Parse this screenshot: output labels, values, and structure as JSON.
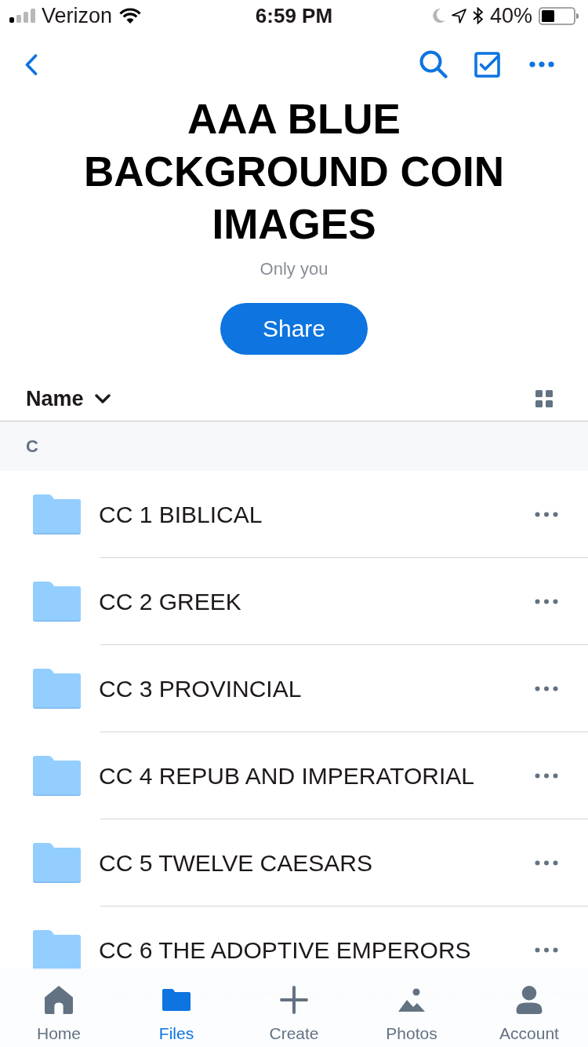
{
  "status_bar": {
    "carrier": "Verizon",
    "time": "6:59 PM",
    "battery_percent": "40%"
  },
  "title": "AAA BLUE BACKGROUND COIN IMAGES",
  "subtitle": "Only you",
  "share_button": "Share",
  "sort": {
    "label": "Name"
  },
  "section": {
    "header": "C"
  },
  "folders": [
    {
      "name": "CC 1 BIBLICAL"
    },
    {
      "name": "CC 2 GREEK"
    },
    {
      "name": "CC 3 PROVINCIAL"
    },
    {
      "name": "CC 4 REPUB AND IMPERATORIAL"
    },
    {
      "name": "CC 5 TWELVE CAESARS"
    },
    {
      "name": "CC 6 THE ADOPTIVE EMPERORS"
    }
  ],
  "tabs": [
    {
      "label": "Home",
      "kind": "home",
      "selected": false
    },
    {
      "label": "Files",
      "kind": "files",
      "selected": true
    },
    {
      "label": "Create",
      "kind": "create",
      "selected": false
    },
    {
      "label": "Photos",
      "kind": "photos",
      "selected": false
    },
    {
      "label": "Account",
      "kind": "account",
      "selected": false
    }
  ]
}
